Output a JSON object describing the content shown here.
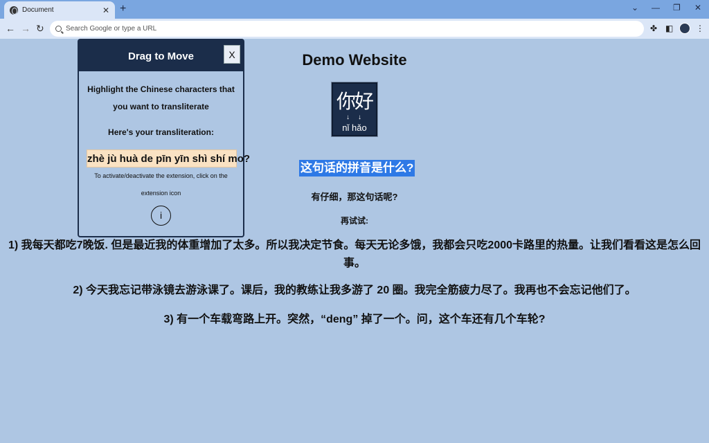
{
  "browser": {
    "tab_title": "Document",
    "tab_close": "✕",
    "new_tab": "+",
    "omnibox_placeholder": "Search Google or type a URL",
    "minimize": "⌄",
    "restore": "—",
    "maximize": "❐",
    "close": "✕"
  },
  "page": {
    "title": "Demo Website",
    "logo_chars": "你好",
    "logo_arrows": "↓↓",
    "logo_pinyin": "nǐ hǎo",
    "highlighted_question": "这句话的拼音是什么?",
    "sub_question": "有仔细，那这句话呢?",
    "retry_label": "再试试:",
    "sentences": [
      "1) 我每天都吃7晚饭. 但是最近我的体重增加了太多。所以我决定节食。每天无论多饿，我都会只吃2000卡路里的热量。让我们看看这是怎么回事。",
      "2) 今天我忘记带泳镜去游泳课了。课后，我的教练让我多游了 20 圈。我完全筋疲力尽了。我再也不会忘记他们了。",
      "3) 有一个车载弯路上开。突然，“deng” 掉了一个。问，这个车还有几个车轮?"
    ]
  },
  "popup": {
    "title": "Drag to Move",
    "close_label": "X",
    "instruction_line1": "Highlight the Chinese characters that",
    "instruction_line2": "you want to transliterate",
    "result_label": "Here's your transliteration:",
    "transliteration": "zhè jù huà de pīn yīn shì shí mo?",
    "hint_line1": "To activate/deactivate the extension, click on the",
    "hint_line2": "extension icon",
    "info_label": "i"
  }
}
